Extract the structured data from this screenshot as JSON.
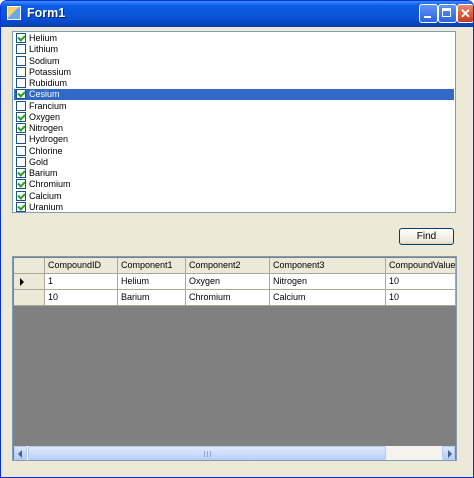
{
  "window": {
    "title": "Form1",
    "colors": {
      "titlebar": "#0a55d9",
      "selection": "#316ac5",
      "grid_background": "#808080"
    }
  },
  "elements_list": {
    "items": [
      {
        "label": "Helium",
        "checked": true
      },
      {
        "label": "Lithium",
        "checked": false
      },
      {
        "label": "Sodium",
        "checked": false
      },
      {
        "label": "Potassium",
        "checked": false
      },
      {
        "label": "Rubidium",
        "checked": false
      },
      {
        "label": "Cesium",
        "checked": true,
        "selected": true
      },
      {
        "label": "Francium",
        "checked": false
      },
      {
        "label": "Oxygen",
        "checked": true
      },
      {
        "label": "Nitrogen",
        "checked": true
      },
      {
        "label": "Hydrogen",
        "checked": false
      },
      {
        "label": "Chlorine",
        "checked": false
      },
      {
        "label": "Gold",
        "checked": false
      },
      {
        "label": "Barium",
        "checked": true
      },
      {
        "label": "Chromium",
        "checked": true
      },
      {
        "label": "Calcium",
        "checked": true
      },
      {
        "label": "Uranium",
        "checked": true
      }
    ]
  },
  "find_button": {
    "label": "Find"
  },
  "grid": {
    "columns": [
      "CompoundID",
      "Component1",
      "Component2",
      "Component3",
      "CompoundValue"
    ],
    "rows": [
      [
        "1",
        "Helium",
        "Oxygen",
        "Nitrogen",
        "10"
      ],
      [
        "10",
        "Barium",
        "Chromium",
        "Calcium",
        "10"
      ]
    ],
    "current_row": 0
  },
  "icons": {
    "app": "form-icon",
    "row_indicator": "current-row-arrow-icon",
    "check": "checkmark-icon"
  }
}
